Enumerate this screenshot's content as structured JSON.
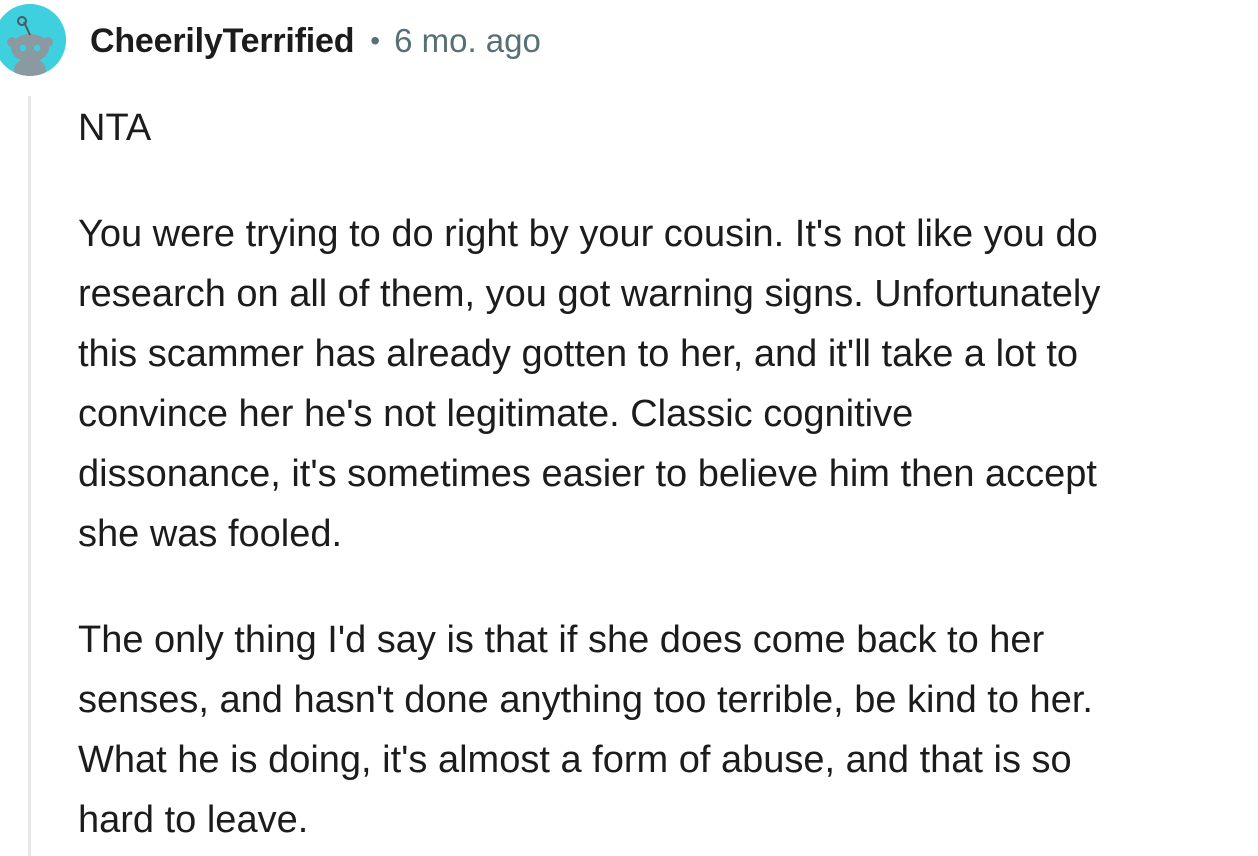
{
  "comment": {
    "username": "CheerilyTerrified",
    "separator": "•",
    "timestamp": "6 mo. ago",
    "avatar_icon": "snoo-avatar-icon",
    "avatar_color": "#3fd0e0",
    "paragraphs": [
      {
        "lines": [
          "NTA"
        ]
      },
      {
        "lines": [
          "You were trying to do right by your cousin. It's not like you do",
          "research on all of them, you got warning signs. Unfortunately",
          "this scammer has already gotten to her, and it'll take a lot to",
          "convince her he's not legitimate. Classic cognitive",
          "dissonance, it's sometimes easier to believe him then accept",
          "she was fooled."
        ]
      },
      {
        "lines": [
          "The only thing I'd say is that if she does come back to her",
          "senses, and hasn't done anything too terrible, be kind to her.",
          "What he is doing, it's almost a form of abuse, and that is so",
          "hard to leave."
        ]
      }
    ]
  }
}
